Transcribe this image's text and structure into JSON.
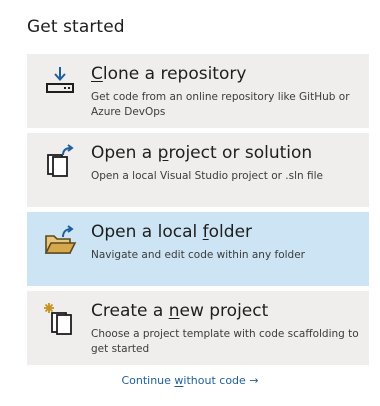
{
  "heading": "Get started",
  "cards": [
    {
      "title_pre": "",
      "title_key": "C",
      "title_post": "lone a repository",
      "description": "Get code from an online repository like GitHub or Azure DevOps",
      "icon": "clone-repository-icon",
      "selected": false
    },
    {
      "title_pre": "Open a ",
      "title_key": "p",
      "title_post": "roject or solution",
      "description": "Open a local Visual Studio project or .sln file",
      "icon": "open-project-icon",
      "selected": false
    },
    {
      "title_pre": "Open a local ",
      "title_key": "f",
      "title_post": "older",
      "description": "Navigate and edit code within any folder",
      "icon": "open-folder-icon",
      "selected": true
    },
    {
      "title_pre": "Create a ",
      "title_key": "n",
      "title_post": "ew project",
      "description": "Choose a project template with code scaffolding to get started",
      "icon": "new-project-icon",
      "selected": false
    }
  ],
  "continue_link": {
    "pre": "Continue ",
    "key": "w",
    "post": "ithout code",
    "arrow": "→"
  },
  "colors": {
    "card_bg": "#efeeed",
    "card_selected_bg": "#cce4f4",
    "accent_blue": "#1f5e9c",
    "folder_yellow": "#d7a84b"
  }
}
